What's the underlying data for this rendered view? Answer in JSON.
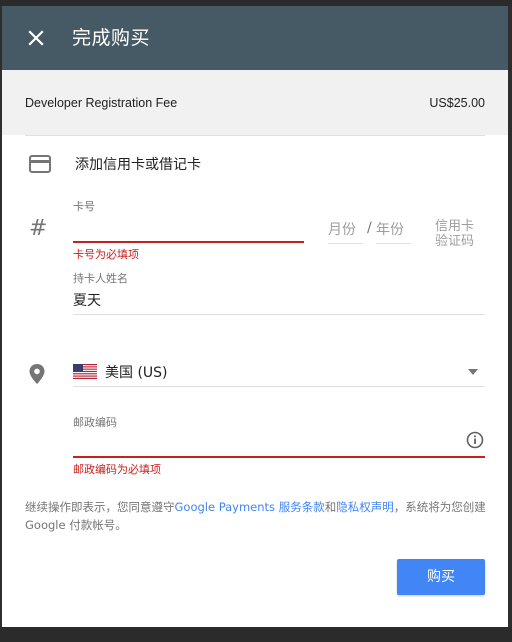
{
  "header": {
    "title": "完成购买",
    "close_icon": "close-icon",
    "background": "#455a64"
  },
  "summary": {
    "item": "Developer Registration Fee",
    "price": "US$25.00"
  },
  "payment": {
    "add_card_label": "添加信用卡或借记卡",
    "card_icon": "credit-card-icon",
    "card_number": {
      "label": "卡号",
      "value": "",
      "error": "卡号为必填项",
      "icon": "hash-icon",
      "icon_glyph": "#"
    },
    "expiry": {
      "month_placeholder": "月份",
      "separator": "/",
      "year_placeholder": "年份"
    },
    "cvc": {
      "placeholder": "信用卡验证码"
    },
    "cardholder": {
      "label": "持卡人姓名",
      "value": "夏天"
    },
    "country": {
      "icon": "location-pin-icon",
      "flag": "us-flag-icon",
      "value": "美国 (US)"
    },
    "postal": {
      "label": "邮政编码",
      "value": "",
      "error": "邮政编码为必填项",
      "info_icon": "info-icon"
    }
  },
  "terms": {
    "prefix": "继续操作即表示，您同意遵守",
    "link1": "Google Payments 服务条款",
    "and": "和",
    "link2": "隐私权声明",
    "suffix": "，系统将为您创建 Google 付款帐号。"
  },
  "actions": {
    "buy_label": "购买"
  },
  "colors": {
    "accent": "#4285f4",
    "error": "#c5221f"
  }
}
